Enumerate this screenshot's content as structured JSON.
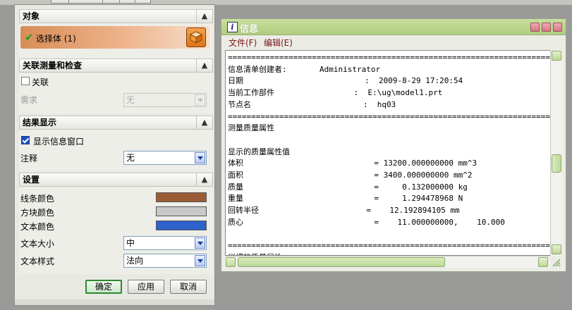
{
  "dialog": {
    "sections": {
      "object": {
        "title": "对象",
        "select_label": "选择体 (1)",
        "collapse_icon": "chevron-up-icon"
      },
      "measure": {
        "title": "关联测量和检查",
        "associate_label": "关联",
        "associate_checked": false,
        "requirement_label": "需求",
        "requirement_value": "无"
      },
      "results": {
        "title": "结果显示",
        "show_info_label": "显示信息窗口",
        "show_info_checked": true,
        "annotation_label": "注释",
        "annotation_value": "无"
      },
      "settings": {
        "title": "设置",
        "line_color_label": "线条颜色",
        "line_color": "#9a5c34",
        "block_color_label": "方块颜色",
        "block_color": "#c9c9c9",
        "text_color_label": "文本颜色",
        "text_color": "#2d62cc",
        "text_size_label": "文本大小",
        "text_size_value": "中",
        "text_style_label": "文本样式",
        "text_style_value": "法向"
      }
    },
    "buttons": {
      "ok": "确定",
      "apply": "应用",
      "cancel": "取消"
    }
  },
  "info_window": {
    "title": "信息",
    "menu": {
      "file": "文件(F)",
      "edit": "编辑(E)"
    },
    "lines": [
      "=======================================================================",
      "信息清单创建者:       Administrator",
      "日期                          :  2009-8-29 17:20:54",
      "当前工作部件                 :  E:\\ug\\model1.prt",
      "节点名                        :  hq03",
      "=======================================================================",
      "测量质量属性",
      "",
      "显示的质量属性值",
      "体积                            = 13200.000000000 mm^3",
      "面积                            = 3400.000000000 mm^2",
      "质量                            =     0.132000000 kg",
      "重量                            =     1.294478968 N",
      "回转半径                       =    12.192894105 mm",
      "质心                            =    11.000000000,    10.000",
      "",
      "=======================================================================",
      "详细的质量属性"
    ]
  },
  "colors": {
    "accent_green": "#b0cd80",
    "ok_border": "#2c8a2c"
  }
}
